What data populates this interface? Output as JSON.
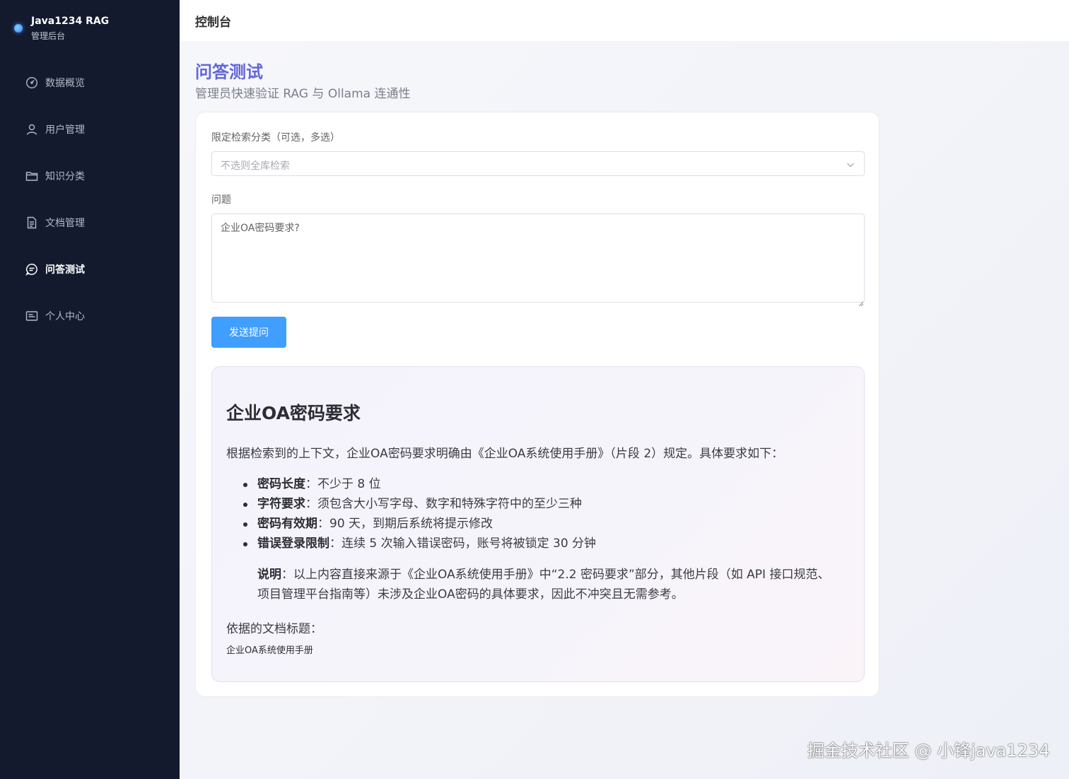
{
  "brand": {
    "title": "Java1234 RAG",
    "subtitle": "管理后台"
  },
  "sidebar": {
    "items": [
      {
        "label": "数据概览",
        "icon": "dashboard-icon"
      },
      {
        "label": "用户管理",
        "icon": "user-icon"
      },
      {
        "label": "知识分类",
        "icon": "folder-icon"
      },
      {
        "label": "文档管理",
        "icon": "document-icon"
      },
      {
        "label": "问答测试",
        "icon": "chat-icon",
        "active": true
      },
      {
        "label": "个人中心",
        "icon": "profile-card-icon"
      }
    ]
  },
  "header": {
    "title": "控制台"
  },
  "page": {
    "title": "问答测试",
    "subtitle": "管理员快速验证 RAG 与 Ollama 连通性"
  },
  "form": {
    "category_label": "限定检索分类（可选，多选）",
    "category_placeholder": "不选则全库检索",
    "question_label": "问题",
    "question_value": "企业OA密码要求?",
    "send_label": "发送提问"
  },
  "answer": {
    "title": "企业OA密码要求",
    "intro": "根据检索到的上下文，企业OA密码要求明确由《企业OA系统使用手册》（片段 2）规定。具体要求如下：",
    "items": [
      {
        "key": "密码长度",
        "text": "：不少于 8 位"
      },
      {
        "key": "字符要求",
        "text": "：须包含大小写字母、数字和特殊字符中的至少三种"
      },
      {
        "key": "密码有效期",
        "text": "：90 天，到期后系统将提示修改"
      },
      {
        "key": "错误登录限制",
        "text": "：连续 5 次输入错误密码，账号将被锁定 30 分钟"
      }
    ],
    "note_key": "说明",
    "note_text": "：以上内容直接来源于《企业OA系统使用手册》中“2.2 密码要求”部分，其他片段（如 API 接口规范、项目管理平台指南等）未涉及企业OA密码的具体要求，因此不冲突且无需参考。",
    "source_label": "依据的文档标题：",
    "source_value": "企业OA系统使用手册"
  },
  "watermark": "掘金技术社区 @ 小锋java1234",
  "colors": {
    "sidebar_bg": "#131a2e",
    "accent": "#6366d9",
    "primary_button": "#409eff"
  }
}
